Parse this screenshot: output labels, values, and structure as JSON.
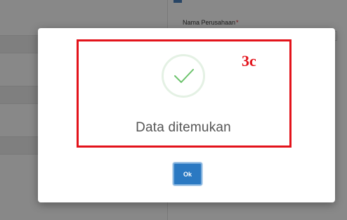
{
  "background": {
    "field_label": "Nama Perusahaan",
    "required_marker": "*"
  },
  "modal": {
    "icon": "checkmark-icon",
    "message": "Data ditemukan",
    "ok_label": "Ok"
  },
  "annotation": {
    "label": "3c",
    "color": "#e3131b"
  },
  "colors": {
    "primary_button": "#2b79c2",
    "checkmark": "#6cc36c",
    "overlay": "rgba(0,0,0,0.45)"
  }
}
